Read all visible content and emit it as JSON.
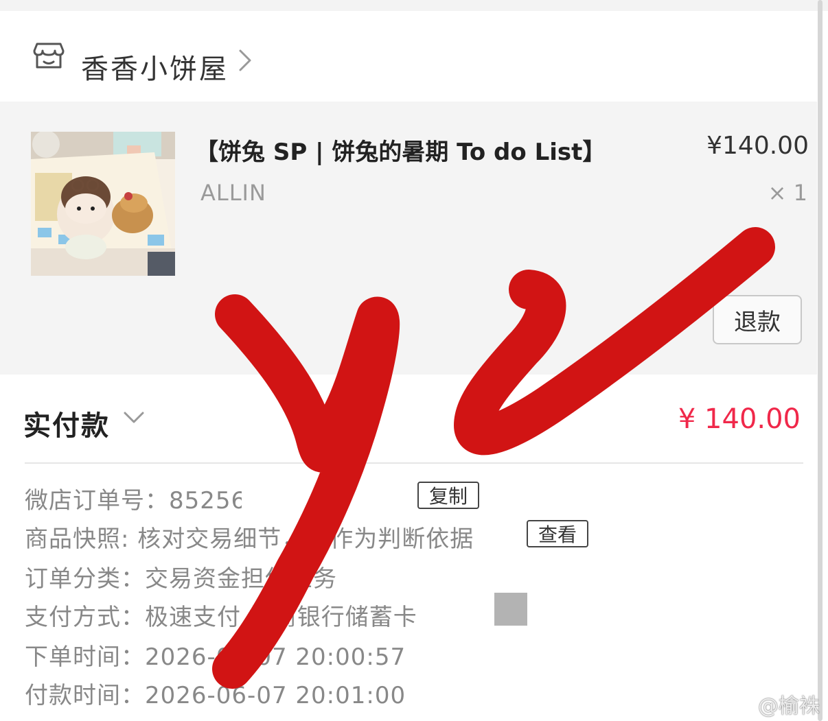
{
  "shop": {
    "name": "香香小饼屋",
    "icon": "store-icon",
    "chevron_icon": "chevron-right-icon"
  },
  "product": {
    "title": "【饼兔 SP | 饼兔的暑期 To do List】",
    "price": "¥140.00",
    "sku": "ALLIN",
    "quantity": "× 1",
    "refund_label": "退款"
  },
  "payment": {
    "paid_label": "实付款",
    "paid_amount": "¥ 140.00",
    "accent_color": "#f0284a"
  },
  "order_info": {
    "order_no_label": "微店订单号：",
    "order_no_value": "85256",
    "copy_label": "复制",
    "snapshot_label": "商品快照:",
    "snapshot_value": "核对交易细节，可作为判断依据",
    "view_label": "查看",
    "category_label": "订单分类：",
    "category_value": "交易资金担保业务",
    "pay_method_label": "支付方式：",
    "pay_method_value": "极速支付 招商银行储蓄卡",
    "order_time_label": "下单时间：",
    "order_time_value": "2026-06-07 20:00:57",
    "pay_time_label": "付款时间：",
    "pay_time_value": "2026-06-07 20:01:00"
  },
  "watermark": "@榆袾",
  "overlay": {
    "scribble_color": "#d11414"
  }
}
